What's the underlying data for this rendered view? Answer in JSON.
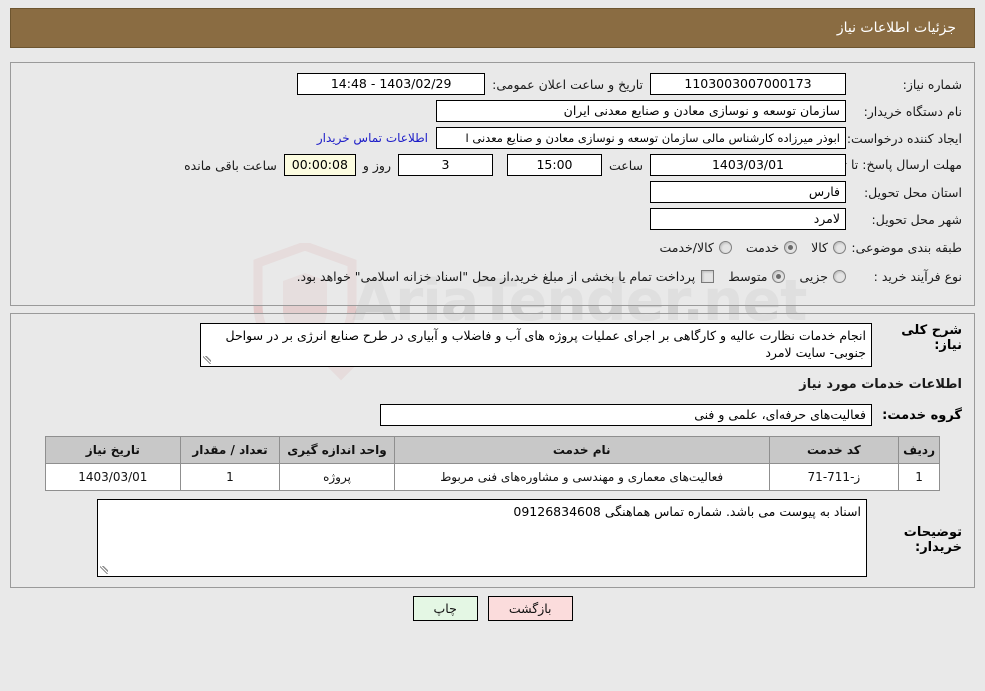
{
  "header": {
    "title": "جزئیات اطلاعات نیاز"
  },
  "info": {
    "need_number_label": "شماره نیاز:",
    "need_number": "1103003007000173",
    "announce_label": "تاریخ و ساعت اعلان عمومی:",
    "announce_value": "1403/02/29 - 14:48",
    "buyer_org_label": "نام دستگاه خریدار:",
    "buyer_org": "سازمان توسعه و نوسازی معادن و صنایع معدنی ایران",
    "requester_label": "ایجاد کننده درخواست:",
    "requester": "ابوذر میرزاده  کارشناس مالی  سازمان توسعه و نوسازی معادن و صنایع معدنی ا",
    "contact_link": "اطلاعات تماس خریدار",
    "deadline_label": "مهلت ارسال پاسخ: تا تاریخ:",
    "deadline_date": "1403/03/01",
    "hour_label": "ساعت",
    "deadline_time": "15:00",
    "days_value": "3",
    "days_label": "روز و",
    "countdown": "00:00:08",
    "remaining_label": "ساعت باقی مانده",
    "province_label": "استان محل تحویل:",
    "province": "فارس",
    "city_label": "شهر محل تحویل:",
    "city": "لامرد",
    "category_label": "طبقه بندی موضوعی:",
    "category_options": [
      {
        "label": "کالا",
        "selected": false
      },
      {
        "label": "خدمت",
        "selected": true
      },
      {
        "label": "کالا/خدمت",
        "selected": false
      }
    ],
    "process_label": "نوع فرآیند خرید :",
    "process_options": [
      {
        "label": "جزیی",
        "selected": false
      },
      {
        "label": "متوسط",
        "selected": true
      }
    ],
    "treasury_note": "پرداخت تمام یا بخشی از مبلغ خرید،از محل \"اسناد خزانه اسلامی\" خواهد بود."
  },
  "details": {
    "desc_label": "شرح کلی نیاز:",
    "desc_text": "انجام خدمات نظارت عالیه و کارگاهی بر اجرای عملیات پروژه های آب و فاضلاب و آبیاری در طرح صنایع انرژی بر در سواحل جنوبی- سایت لامرد",
    "section_title": "اطلاعات خدمات مورد نیاز",
    "group_label": "گروه خدمت:",
    "group_value": "فعالیت‌های حرفه‌ای، علمی و فنی",
    "table": {
      "headers": [
        "ردیف",
        "کد خدمت",
        "نام خدمت",
        "واحد اندازه گیری",
        "تعداد / مقدار",
        "تاریخ نیاز"
      ],
      "rows": [
        {
          "index": "1",
          "code": "ز-711-71",
          "name": "فعالیت‌های معماری و مهندسی و مشاوره‌های فنی مربوط",
          "unit": "پروژه",
          "qty": "1",
          "date": "1403/03/01"
        }
      ]
    },
    "notes_label": "توضیحات خریدار:",
    "notes_text": "اسناد به پیوست می باشد. شماره تماس هماهنگی 09126834608"
  },
  "footer": {
    "print_label": "چاپ",
    "back_label": "بازگشت"
  },
  "watermark": {
    "text": "AriaTender.net"
  }
}
